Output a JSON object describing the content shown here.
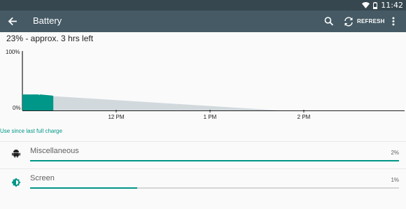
{
  "status_bar": {
    "time": "11:42",
    "icons": [
      "wifi-icon",
      "battery-icon"
    ]
  },
  "app_bar": {
    "title": "Battery",
    "back_icon": "arrow-back-icon",
    "search_icon": "search-icon",
    "refresh_icon": "refresh-icon",
    "refresh_label": "REFRESH",
    "more_icon": "more-vert-icon"
  },
  "summary": "23% - approx. 3 hrs left",
  "chart_data": {
    "type": "area",
    "ytick_labels": [
      "100%",
      "0%"
    ],
    "xtick_labels": [
      "12 PM",
      "1 PM",
      "2 PM"
    ],
    "ylim": [
      0,
      100
    ],
    "series": [
      {
        "role": "history",
        "color": "#009688",
        "points": [
          [
            0,
            27
          ],
          [
            0.17,
            27
          ],
          [
            0.18,
            26
          ],
          [
            0.19,
            27
          ],
          [
            0.32,
            25
          ],
          [
            0.33,
            24
          ]
        ]
      },
      {
        "role": "prediction",
        "color": "#d1d9dd",
        "points": [
          [
            0.33,
            24
          ],
          [
            2.75,
            0
          ]
        ]
      }
    ],
    "grid": false
  },
  "usage_header": "Use since last full charge",
  "colors": {
    "accent": "#009688",
    "app_bar": "#455a64",
    "status_bar": "#37474f"
  },
  "usage_items": [
    {
      "icon": "android-icon",
      "label": "Miscellaneous",
      "percent": "2%",
      "fraction": 1.0
    },
    {
      "icon": "screen-brightness-icon",
      "label": "Screen",
      "percent": "1%",
      "fraction": 0.29
    }
  ]
}
